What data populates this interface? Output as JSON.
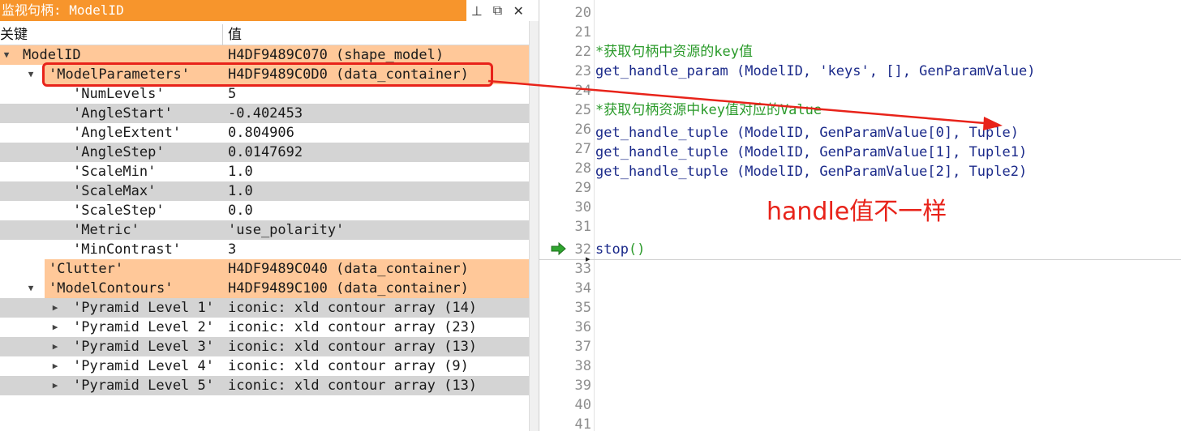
{
  "window": {
    "title": "监视句柄: ModelID",
    "pin_glyph": "⊥",
    "float_glyph": "⧉",
    "close_glyph": "✕"
  },
  "columns": {
    "key": "关键",
    "value": "值"
  },
  "tree": [
    {
      "key": "ModelID",
      "value": "H4DF9489C070 (shape_model)"
    },
    {
      "key": "'ModelParameters'",
      "value": "H4DF9489C0D0 (data_container)"
    },
    {
      "key": "'NumLevels'",
      "value": "5"
    },
    {
      "key": "'AngleStart'",
      "value": "-0.402453"
    },
    {
      "key": "'AngleExtent'",
      "value": "0.804906"
    },
    {
      "key": "'AngleStep'",
      "value": "0.0147692"
    },
    {
      "key": "'ScaleMin'",
      "value": "1.0"
    },
    {
      "key": "'ScaleMax'",
      "value": "1.0"
    },
    {
      "key": "'ScaleStep'",
      "value": "0.0"
    },
    {
      "key": "'Metric'",
      "value": "'use_polarity'"
    },
    {
      "key": "'MinContrast'",
      "value": "3"
    },
    {
      "key": "'Clutter'",
      "value": "H4DF9489C040 (data_container)"
    },
    {
      "key": "'ModelContours'",
      "value": "H4DF9489C100 (data_container)"
    },
    {
      "key": "'Pyramid Level 1'",
      "value": "iconic: xld contour array (14)"
    },
    {
      "key": "'Pyramid Level 2'",
      "value": "iconic: xld contour array (23)"
    },
    {
      "key": "'Pyramid Level 3'",
      "value": "iconic: xld contour array (13)"
    },
    {
      "key": "'Pyramid Level 4'",
      "value": "iconic: xld contour array (9)"
    },
    {
      "key": "'Pyramid Level 5'",
      "value": "iconic: xld contour array (13)"
    }
  ],
  "editor": {
    "lines": [
      {
        "num": "20",
        "text": ""
      },
      {
        "num": "21",
        "text": ""
      },
      {
        "num": "22",
        "text": "*获取句柄中资源的key值"
      },
      {
        "num": "23",
        "text": "get_handle_param (ModelID, 'keys', [], GenParamValue)"
      },
      {
        "num": "24",
        "text": ""
      },
      {
        "num": "25",
        "text": "*获取句柄资源中key值对应的Value"
      },
      {
        "num": "26",
        "text": "get_handle_tuple (ModelID, GenParamValue[0], Tuple)"
      },
      {
        "num": "27",
        "text": "get_handle_tuple (ModelID, GenParamValue[1], Tuple1)"
      },
      {
        "num": "28",
        "text": "get_handle_tuple (ModelID, GenParamValue[2], Tuple2)"
      },
      {
        "num": "29",
        "text": ""
      },
      {
        "num": "30",
        "text": ""
      },
      {
        "num": "31",
        "text": ""
      },
      {
        "num": "32",
        "text": "stop"
      },
      {
        "num": "33",
        "text": ""
      },
      {
        "num": "34",
        "text": ""
      },
      {
        "num": "35",
        "text": ""
      },
      {
        "num": "36",
        "text": ""
      },
      {
        "num": "37",
        "text": ""
      },
      {
        "num": "38",
        "text": ""
      },
      {
        "num": "39",
        "text": ""
      },
      {
        "num": "40",
        "text": ""
      },
      {
        "num": "41",
        "text": ""
      }
    ],
    "stop_parens": "()",
    "cursor_glyph": "▸"
  },
  "annotation": {
    "text": "handle值不一样",
    "color": "#e8231a"
  },
  "colors": {
    "title_bar": "#f7952c",
    "row_orange": "#ffc899",
    "row_grey": "#d4d4d4",
    "comment": "#2a9a2a",
    "code": "#1b2a8a",
    "pc_arrow": "#2fa52f"
  }
}
